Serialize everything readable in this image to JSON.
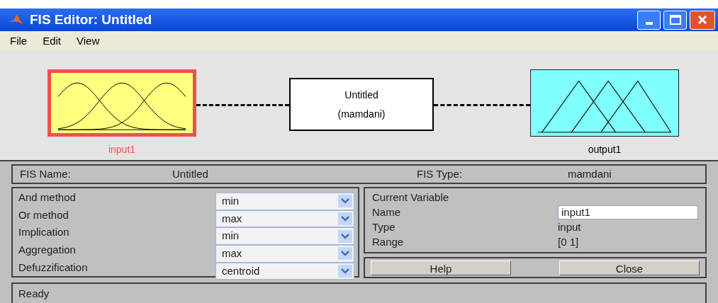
{
  "window": {
    "title": "FIS Editor: Untitled"
  },
  "menu": [
    "File",
    "Edit",
    "View"
  ],
  "diagram": {
    "inputs": [
      {
        "label": "input1",
        "selected": true
      }
    ],
    "system": {
      "name": "Untitled",
      "type": "(mamdani)",
      "selected": false
    },
    "outputs": [
      {
        "label": "output1",
        "selected": false
      }
    ]
  },
  "fis_info": {
    "name_label": "FIS Name:",
    "name": "Untitled",
    "type_label": "FIS Type:",
    "type": "mamdani"
  },
  "methods": [
    {
      "label": "And method",
      "value": "min"
    },
    {
      "label": "Or method",
      "value": "max"
    },
    {
      "label": "Implication",
      "value": "min"
    },
    {
      "label": "Aggregation",
      "value": "max"
    },
    {
      "label": "Defuzzification",
      "value": "centroid"
    }
  ],
  "current_variable": {
    "title": "Current Variable",
    "name_label": "Name",
    "name": "input1",
    "type_label": "Type",
    "type": "input",
    "range_label": "Range",
    "range": "[0 1]"
  },
  "buttons": [
    "Help",
    "Close"
  ],
  "status_bar": "Ready"
}
